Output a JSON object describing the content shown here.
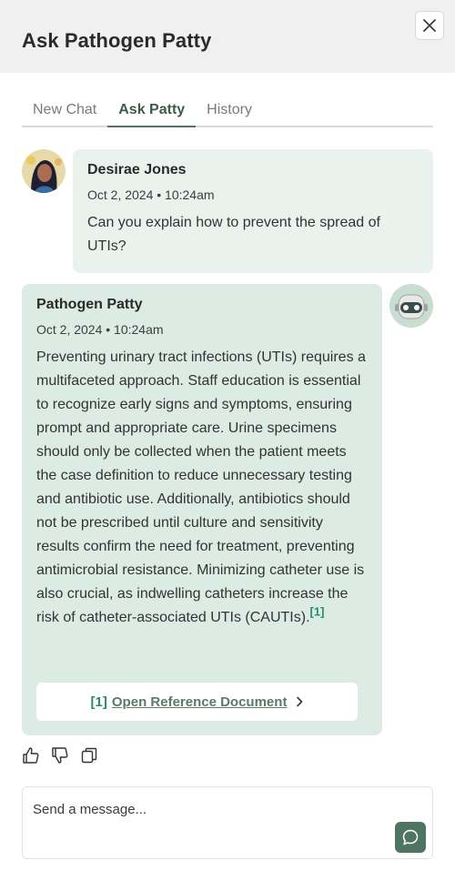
{
  "header": {
    "title": "Ask Pathogen Patty",
    "close_icon": "close-icon"
  },
  "tabs": [
    {
      "label": "New Chat",
      "active": false
    },
    {
      "label": "Ask Patty",
      "active": true
    },
    {
      "label": "History",
      "active": false
    }
  ],
  "messages": {
    "user": {
      "name": "Desirae Jones",
      "timestamp": "Oct 2, 2024 • 10:24am",
      "text": "Can you explain how to prevent the spread of UTIs?"
    },
    "bot": {
      "name": "Pathogen Patty",
      "timestamp": "Oct 2, 2024 • 10:24am",
      "text": "Preventing urinary tract infections (UTIs) requires a multifaceted approach. Staff education is essential to recognize early signs and symptoms, ensuring prompt and appropriate care. Urine specimens should only be collected when the patient meets the case definition to reduce unnecessary testing and antibiotic use. Additionally, antibiotics should not be prescribed until culture and sensitivity results confirm the need for treatment, preventing antimicrobial resistance. Minimizing catheter use is also crucial, as indwelling catheters increase the risk of catheter-associated UTIs (CAUTIs).",
      "citation": "[1]",
      "reference": {
        "number": "[1]",
        "label": "Open Reference Document"
      }
    }
  },
  "actions": {
    "like_icon": "thumbs-up-icon",
    "dislike_icon": "thumbs-down-icon",
    "copy_icon": "copy-icon"
  },
  "composer": {
    "placeholder": "Send a message...",
    "value": ""
  },
  "colors": {
    "accent": "#4f7463",
    "citation": "#2a8a6c",
    "user_bubble": "#eaf2ee",
    "bot_bubble": "#dcebe4",
    "header_bg": "#f0f0f0"
  }
}
